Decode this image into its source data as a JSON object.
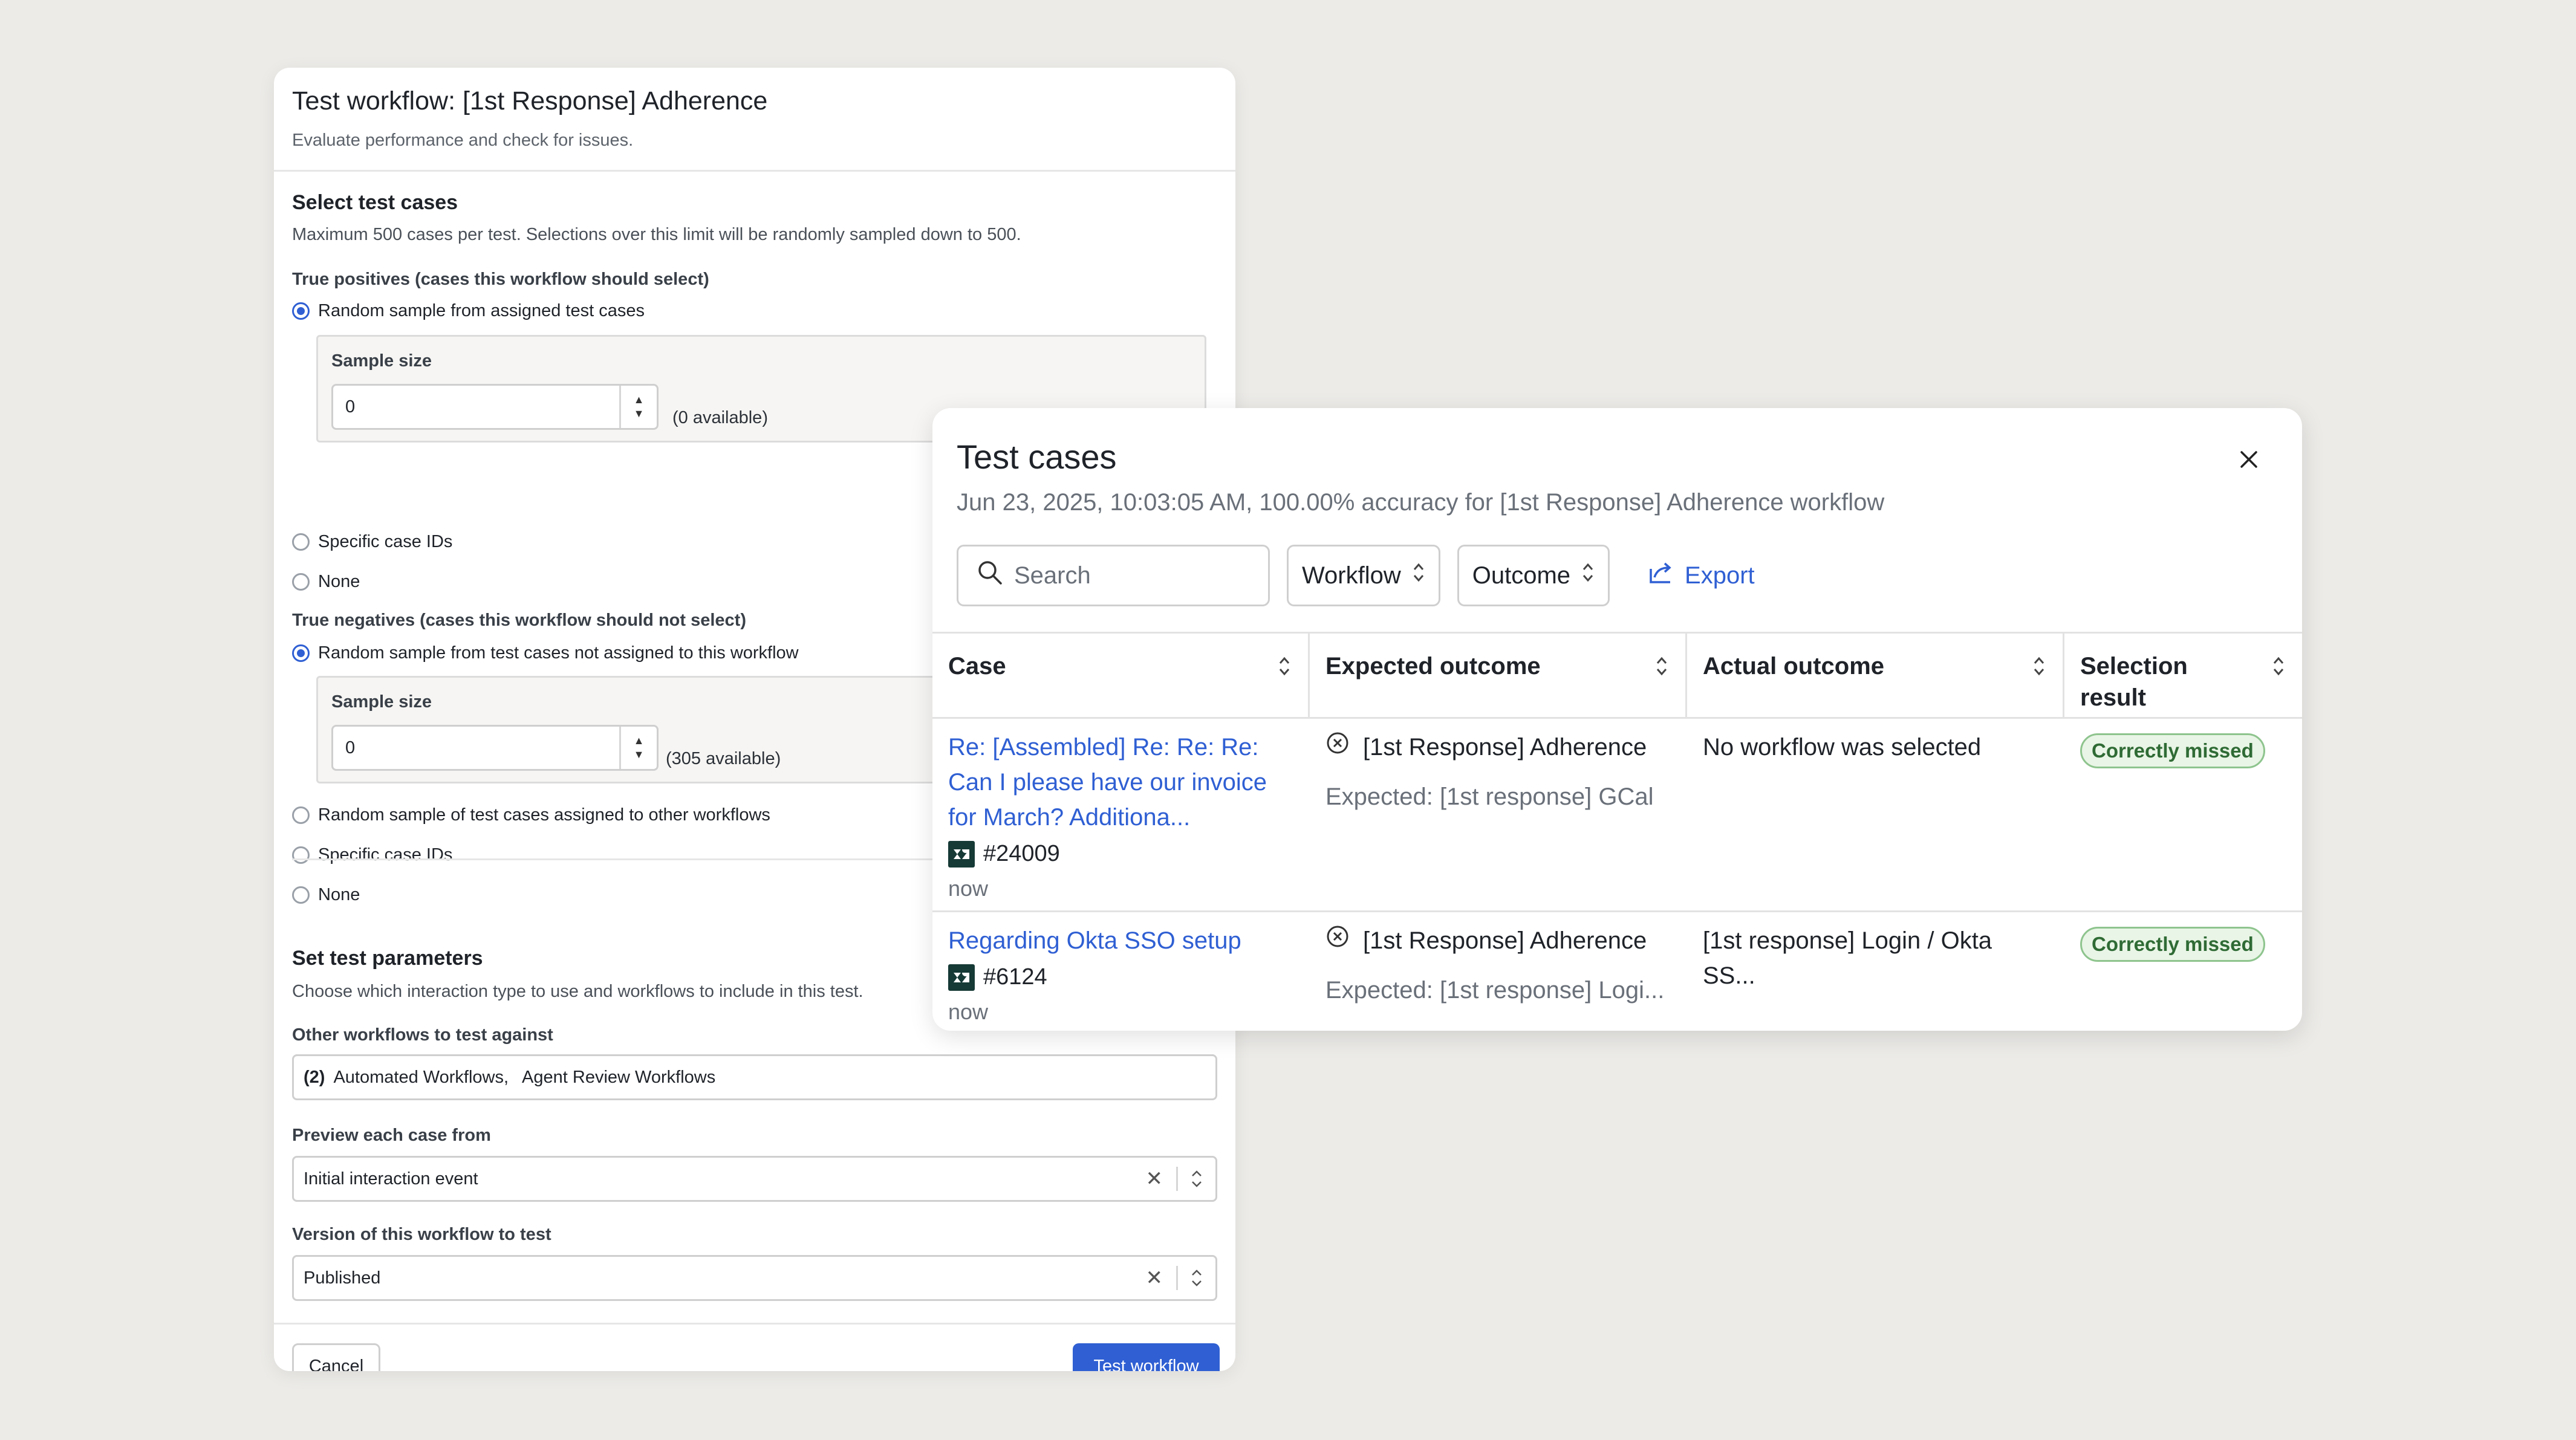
{
  "workflow_panel": {
    "title": "Test workflow: [1st Response] Adherence",
    "subtitle": "Evaluate performance and check for issues.",
    "select_cases": {
      "title": "Select test cases",
      "description": "Maximum 500 cases per test. Selections over this limit will be randomly sampled down to 500."
    },
    "true_positives": {
      "label": "True positives (cases this workflow should select)",
      "options": [
        "Random sample from assigned test cases",
        "Specific case IDs",
        "None"
      ],
      "selected": "Random sample from assigned test cases",
      "sample_label": "Sample size",
      "sample_value": "0",
      "available": "(0 available)"
    },
    "true_negatives": {
      "label": "True negatives (cases this workflow should not select)",
      "options": [
        "Random sample from test cases not assigned to this workflow",
        "Random sample of test cases assigned to other workflows",
        "Specific case IDs",
        "None"
      ],
      "selected": "Random sample from test cases not assigned to this workflow",
      "sample_label": "Sample size",
      "sample_value": "0",
      "available": "(305 available)"
    },
    "parameters": {
      "title": "Set test parameters",
      "description": "Choose which interaction type to use and workflows to include in this test.",
      "other_workflows_label": "Other workflows to test against",
      "other_workflows_count": "(2)",
      "other_workflows": [
        "Automated Workflows,",
        "Agent Review Workflows"
      ],
      "preview_label": "Preview each case from",
      "preview_value": "Initial interaction event",
      "version_label": "Version of this workflow to test",
      "version_value": "Published"
    },
    "cancel_label": "Cancel",
    "submit_label": "Test workflow"
  },
  "test_cases_modal": {
    "title": "Test cases",
    "subtitle": "Jun 23, 2025, 10:03:05 AM, 100.00% accuracy for [1st Response] Adherence workflow",
    "search_placeholder": "Search",
    "filters": [
      "Workflow",
      "Outcome"
    ],
    "export_label": "Export",
    "columns": [
      "Case",
      "Expected outcome",
      "Actual outcome",
      "Selection result"
    ],
    "rows": [
      {
        "case_title": "Re: [Assembled] Re: Re: Re: Can I please have our invoice for March? Additiona...",
        "case_id": "#24009",
        "time": "now",
        "expected": "[1st Response] Adherence",
        "expected_sub": "Expected: [1st response] GCal",
        "actual": "No workflow was selected",
        "result": "Correctly missed"
      },
      {
        "case_title": "Regarding Okta SSO setup",
        "case_id": "#6124",
        "time": "now",
        "expected": "[1st Response] Adherence",
        "expected_sub": "Expected: [1st response] Logi...",
        "actual": "[1st response] Login / Okta SS...",
        "result": "Correctly missed"
      }
    ]
  },
  "colors": {
    "primary": "#2f5fd3",
    "success_text": "#2f6b35",
    "success_bg": "#e9f5e6",
    "background": "#ecebe8"
  },
  "icons": {
    "close": "close-icon",
    "search": "search-icon",
    "sort": "sort-icon",
    "export": "export-icon",
    "zendesk": "zendesk-icon",
    "circle_x": "circle-x-icon"
  }
}
